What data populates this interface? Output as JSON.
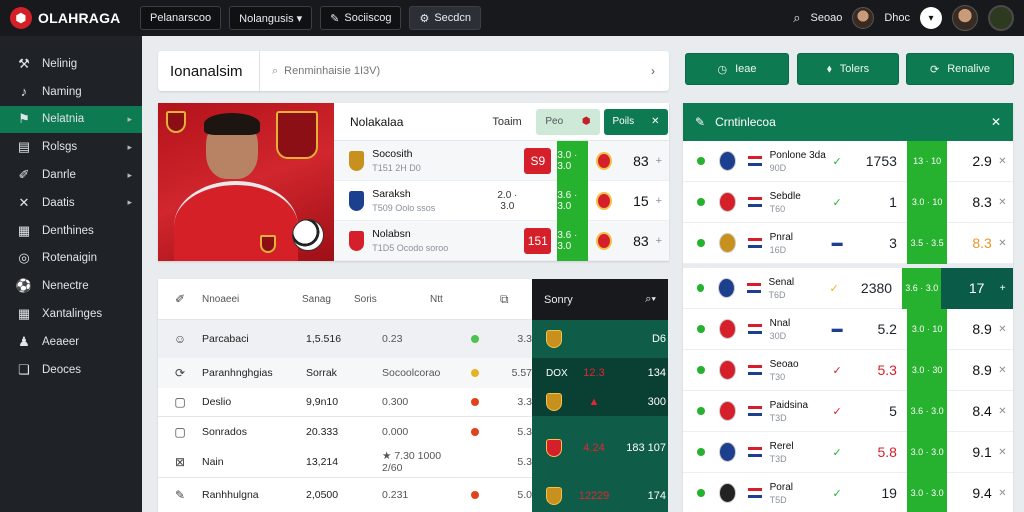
{
  "app": {
    "logo_text": "OLAHRAGA"
  },
  "topbar": {
    "buttons": [
      {
        "label": "Pelanarscoo"
      },
      {
        "label": "Nolangusis ▾"
      },
      {
        "label": "Sociiscog"
      },
      {
        "label": "Secdcn"
      }
    ],
    "search_label": "Seoao",
    "user_label": "Dhoc"
  },
  "sidebar": {
    "items": [
      {
        "label": "Nelinig",
        "icon": "tools-icon"
      },
      {
        "label": "Naming",
        "icon": "whistle-icon"
      },
      {
        "label": "Nelatnia",
        "icon": "flag-icon",
        "active": true
      },
      {
        "label": "Rolsgs",
        "icon": "chart-icon"
      },
      {
        "label": "Danrle",
        "icon": "boot-icon"
      },
      {
        "label": "Daatis",
        "icon": "cross-icon"
      },
      {
        "label": "Denthines",
        "icon": "table-icon"
      },
      {
        "label": "Rotenaigin",
        "icon": "target-icon"
      },
      {
        "label": "Nenectre",
        "icon": "ball-icon"
      },
      {
        "label": "Xantalinges",
        "icon": "grid-icon"
      },
      {
        "label": "Aeaeer",
        "icon": "user-icon"
      },
      {
        "label": "Deoces",
        "icon": "doc-icon"
      }
    ]
  },
  "search": {
    "title": "Ionanalsim",
    "placeholder": "Renminhaisie 1I3V)"
  },
  "actions": [
    {
      "label": "Ieae",
      "icon": "clock-icon"
    },
    {
      "label": "Tolers",
      "icon": "tag-icon"
    },
    {
      "label": "Renalive",
      "icon": "refresh-icon"
    }
  ],
  "featured": {
    "header_title": "Nolakalaa",
    "header_sub": "Toaim",
    "pill_label": "Peo",
    "tab_label": "Poils",
    "fixtures": [
      {
        "team": "Socosith",
        "meta": "T151  2H  D0",
        "odds": "",
        "chip": "S9",
        "chip_color": "red",
        "green": "3.0 · 3.0",
        "value": "83"
      },
      {
        "team": "Saraksh",
        "meta": "T509  Oolo ssos",
        "odds": "2.0 · 3.0",
        "chip": "",
        "chip_color": "",
        "green": "3.6 · 3.0",
        "value": "15"
      },
      {
        "team": "Nolabsn",
        "meta": "T1D5  Ocodo soroo",
        "odds": "",
        "chip": "151",
        "chip_color": "red",
        "green": "3.6 · 3.0",
        "value": "83"
      }
    ]
  },
  "standings": {
    "headers": [
      "Nnoaeei",
      "Sanag",
      "Soris",
      "Ntt"
    ],
    "rows": [
      {
        "icon": "face-icon",
        "name": "Parcabaci",
        "v1": "1,5.516",
        "v2": "0.23",
        "dot": "#4cc24f",
        "v3": "3.3",
        "shade": true
      },
      {
        "icon": "refresh-icon",
        "name": "Paranhnghgias",
        "v1": "Sorrak",
        "v2": "Socoolcorao",
        "dot": "#e6b422",
        "v3": "5.57",
        "shade": false
      },
      {
        "icon": "square-icon",
        "name": "Deslio",
        "v1": "9,9n10",
        "v2": "0.300",
        "dot": "#e0431c",
        "v3": "3.3",
        "shade": false
      },
      {
        "icon": "square-icon",
        "name": "Sonrados",
        "v1": "20.333",
        "v2": "0.000",
        "dot": "#e0431c",
        "v3": "5.3",
        "shade": false
      },
      {
        "icon": "x-icon",
        "name": "Nain",
        "v1": "13,214",
        "v2": "★ 7.30   1000  2/60",
        "dot": "",
        "v3": "5.3",
        "shade": false
      },
      {
        "icon": "edit-icon",
        "name": "Ranhhulgna",
        "v1": "2,0500",
        "v2": "0.231",
        "dot": "#e0431c",
        "v3": "5.0",
        "shade": false
      }
    ]
  },
  "side_panel": {
    "title": "Sonry",
    "rows": [
      {
        "mid": "",
        "val": "D6",
        "tone": "teal"
      },
      {
        "mid": "12.3",
        "val": "134",
        "tone": "deep",
        "left": "DOX"
      },
      {
        "mid": "▲",
        "val": "300",
        "tone": "deep"
      },
      {
        "mid": "4.24",
        "val": "183  107",
        "tone": "teal"
      },
      {
        "mid": "12229",
        "val": "174",
        "tone": "teal"
      }
    ]
  },
  "live": {
    "title": "Crntinlecoa",
    "rows": [
      {
        "team": "Ponlone 3da",
        "meta": "90D",
        "sym": "✓",
        "sym_color": "#26b12e",
        "num": "1753",
        "green": "13 · 10",
        "val": "2.9"
      },
      {
        "team": "Sebdle",
        "meta": "T60",
        "sym": "✓",
        "sym_color": "#26b12e",
        "num": "1",
        "green": "3.0 · 10",
        "val": "8.3"
      },
      {
        "team": "Pnral",
        "meta": "16D",
        "sym": "▬",
        "sym_color": "#1d3f8f",
        "num": "3",
        "green": "3.5 · 3.5",
        "val": "8.3",
        "orange": true
      },
      {
        "team": "Senal",
        "meta": "T6D",
        "sym": "✓",
        "sym_color": "#e6b422",
        "num": "2380",
        "green": "3.6 · 3.0",
        "val": "17",
        "highlight": true
      },
      {
        "team": "Nnal",
        "meta": "30D",
        "sym": "▬",
        "sym_color": "#1d3f8f",
        "num": "5.2",
        "green": "3.0 · 10",
        "val": "8.9"
      },
      {
        "team": "Seoao",
        "meta": "T30",
        "sym": "✓",
        "sym_color": "#d51f2b",
        "num": "5.3",
        "green": "3.0 · 30",
        "val": "8.9",
        "num_red": true
      },
      {
        "team": "Paidsina",
        "meta": "T3D",
        "sym": "✓",
        "sym_color": "#d51f2b",
        "num": "5",
        "green": "3.6 · 3.0",
        "val": "8.4"
      },
      {
        "team": "Rerel",
        "meta": "T3D",
        "sym": "✓",
        "sym_color": "#26b12e",
        "num": "5.8",
        "green": "3.0 · 3.0",
        "val": "9.1",
        "num_red": true
      },
      {
        "team": "Poral",
        "meta": "T5D",
        "sym": "✓",
        "sym_color": "#26b12e",
        "num": "19",
        "green": "3.0 · 3.0",
        "val": "9.4"
      }
    ]
  },
  "colors": {
    "accent": "#0e7a52",
    "live_green": "#26b12e",
    "alert_red": "#d51f2b",
    "dark": "#17191c"
  }
}
